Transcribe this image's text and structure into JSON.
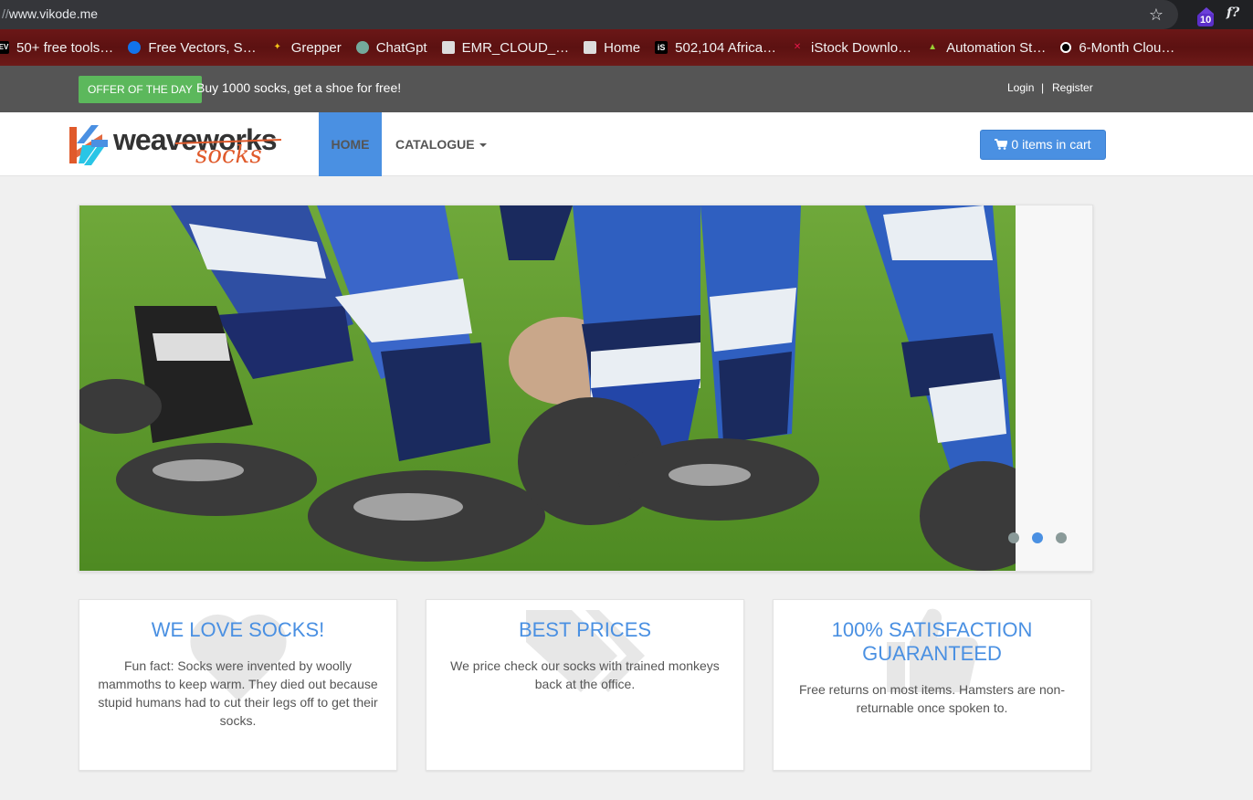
{
  "browser": {
    "url_scheme": "//",
    "url_host": "www.vikode.me",
    "extension_badge": "10",
    "extension2_label": "f?",
    "bookmarks": [
      {
        "label": "50+ free tools…",
        "icon": "dev-icon"
      },
      {
        "label": "Free Vectors, S…",
        "icon": "freepik-icon"
      },
      {
        "label": "Grepper",
        "icon": "grepper-icon"
      },
      {
        "label": "ChatGpt",
        "icon": "chatgpt-icon"
      },
      {
        "label": "EMR_CLOUD_…",
        "icon": "page-icon"
      },
      {
        "label": "Home",
        "icon": "page-icon"
      },
      {
        "label": "502,104 Africa…",
        "icon": "istock-icon"
      },
      {
        "label": "iStock Downlo…",
        "icon": "download-icon"
      },
      {
        "label": "Automation St…",
        "icon": "automation-icon"
      },
      {
        "label": "6-Month Clou…",
        "icon": "circle-icon"
      }
    ]
  },
  "topbar": {
    "offer_badge": "OFFER OF THE DAY",
    "offer_text": "Buy 1000 socks, get a shoe for free!",
    "login": "Login",
    "separator": "|",
    "register": "Register"
  },
  "navbar": {
    "logo_main": "weaveworks",
    "logo_sub": "socks",
    "home": "HOME",
    "catalogue": "CATALOGUE",
    "cart": "0 items in cart"
  },
  "carousel": {
    "slide_count": 3,
    "active_slide": 2
  },
  "features": [
    {
      "title": "WE LOVE SOCKS!",
      "text": "Fun fact: Socks were invented by woolly mammoths to keep warm. They died out because stupid humans had to cut their legs off to get their socks.",
      "icon": "heart-icon"
    },
    {
      "title": "BEST PRICES",
      "text": "We price check our socks with trained monkeys back at the office.",
      "icon": "tags-icon"
    },
    {
      "title": "100% SATISFACTION GUARANTEED",
      "text": "Free returns on most items. Hamsters are non-returnable once spoken to.",
      "icon": "thumbs-up-icon"
    }
  ],
  "colors": {
    "accent": "#4a90e2",
    "offer_green": "#5cb85c",
    "topbar": "#555555",
    "logo_orange": "#e05a2b"
  }
}
